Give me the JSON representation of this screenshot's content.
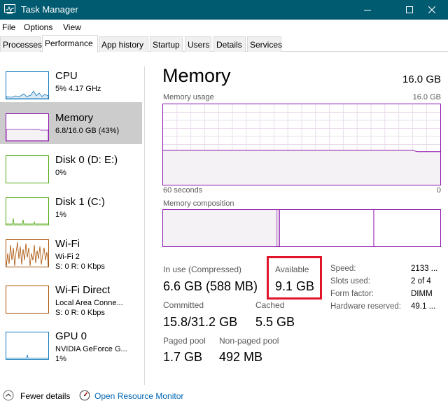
{
  "window": {
    "title": "Task Manager",
    "app_icon": "task-manager-icon"
  },
  "menu": {
    "file": "File",
    "options": "Options",
    "view": "View"
  },
  "tabs": [
    "Processes",
    "Performance",
    "App history",
    "Startup",
    "Users",
    "Details",
    "Services"
  ],
  "active_tab": "Performance",
  "sidebar": {
    "items": [
      {
        "name": "CPU",
        "line1": "5% 4.17 GHz",
        "line2": "",
        "color": "#1177bb",
        "selected": false
      },
      {
        "name": "Memory",
        "line1": "6.8/16.0 GB (43%)",
        "line2": "",
        "color": "#8b12ae",
        "selected": true
      },
      {
        "name": "Disk 0 (D: E:)",
        "line1": "0%",
        "line2": "",
        "color": "#4da60c",
        "selected": false
      },
      {
        "name": "Disk 1 (C:)",
        "line1": "1%",
        "line2": "",
        "color": "#4da60c",
        "selected": false
      },
      {
        "name": "Wi-Fi",
        "line1": "Wi-Fi 2",
        "line2": "S: 0 R: 0 Kbps",
        "color": "#a74f01",
        "selected": false
      },
      {
        "name": "Wi-Fi Direct",
        "line1": "Local Area Conne...",
        "line2": "S: 0 R: 0 Kbps",
        "color": "#a74f01",
        "selected": false
      },
      {
        "name": "GPU 0",
        "line1": "NVIDIA GeForce G...",
        "line2": "1%",
        "color": "#1177bb",
        "selected": false
      }
    ]
  },
  "main": {
    "title": "Memory",
    "total": "16.0 GB",
    "usage_label": "Memory usage",
    "usage_max": "16.0 GB",
    "time_left": "60 seconds",
    "time_right": "0",
    "composition_label": "Memory composition",
    "usage_history_fraction": [
      0.43,
      0.43,
      0.43,
      0.43,
      0.43,
      0.43,
      0.43,
      0.43,
      0.43,
      0.43,
      0.43,
      0.43,
      0.43,
      0.43,
      0.43,
      0.43,
      0.43,
      0.43,
      0.43,
      0.43,
      0.43,
      0.43,
      0.43,
      0.43,
      0.43,
      0.43,
      0.43,
      0.43,
      0.43,
      0.43,
      0.43,
      0.43,
      0.43,
      0.43,
      0.43,
      0.43,
      0.43,
      0.43,
      0.43,
      0.43,
      0.43,
      0.43,
      0.43,
      0.43,
      0.43,
      0.43,
      0.43,
      0.43,
      0.43,
      0.43,
      0.43,
      0.43,
      0.43,
      0.43,
      0.43,
      0.41,
      0.41,
      0.41,
      0.41,
      0.41,
      0.41
    ],
    "composition_fractions": {
      "in_use": 0.41,
      "modified": 0.01,
      "standby": 0.34,
      "free": 0.24
    },
    "stats": {
      "in_use_label": "In use (Compressed)",
      "in_use": "6.6 GB (588 MB)",
      "available_label": "Available",
      "available": "9.1 GB",
      "committed_label": "Committed",
      "committed": "15.8/31.2 GB",
      "cached_label": "Cached",
      "cached": "5.5 GB",
      "paged_label": "Paged pool",
      "paged": "1.7 GB",
      "nonpaged_label": "Non-paged pool",
      "nonpaged": "492 MB"
    },
    "right": {
      "speed_label": "Speed:",
      "speed": "2133 ...",
      "slots_label": "Slots used:",
      "slots": "2 of 4",
      "form_label": "Form factor:",
      "form": "DIMM",
      "hw_label": "Hardware reserved:",
      "hw": "49.1 ..."
    }
  },
  "footer": {
    "fewer_details": "Fewer details",
    "open_resource_monitor": "Open Resource Monitor"
  },
  "colors": {
    "titlebar": "#005a70",
    "memory": "#8b12ae",
    "highlight": "#e0142b",
    "link": "#0066b4"
  }
}
